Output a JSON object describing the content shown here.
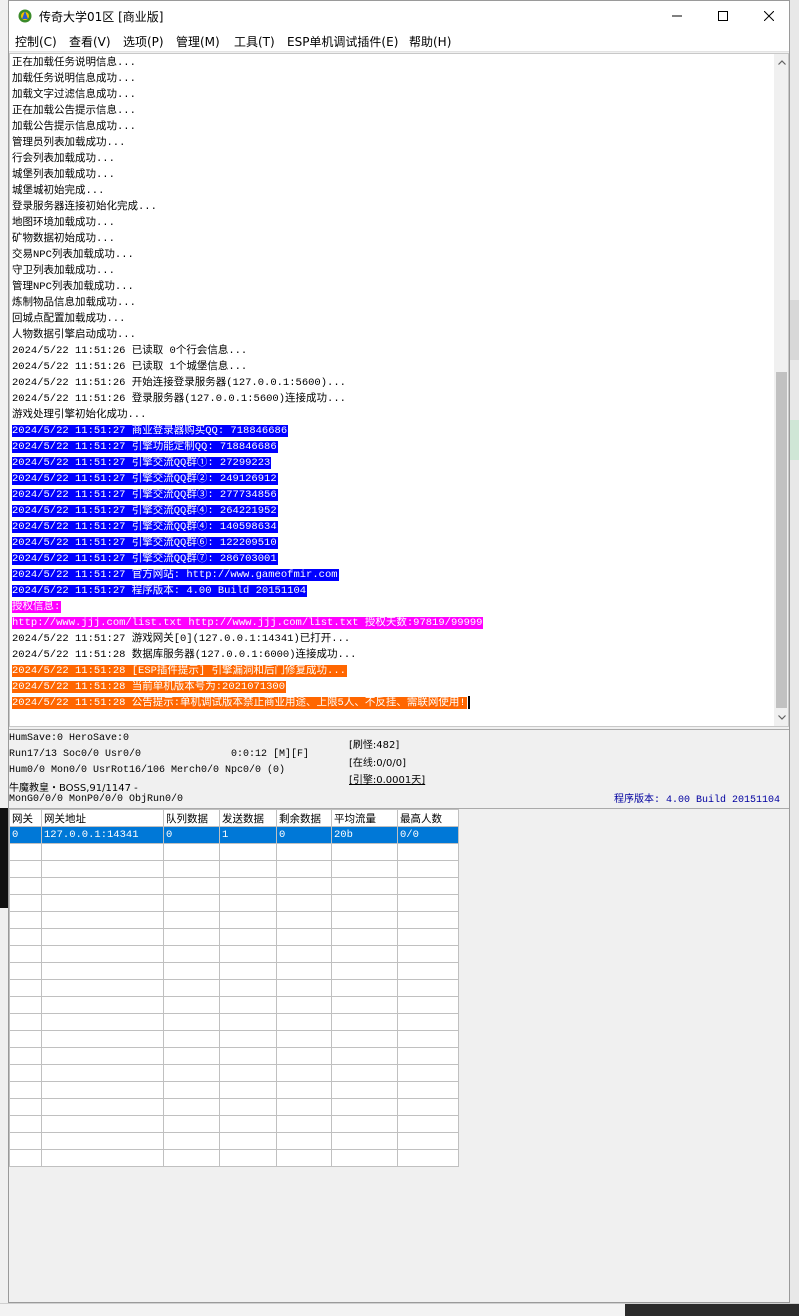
{
  "window": {
    "title": "传奇大学01区 [商业版]"
  },
  "menu": [
    "控制(C)",
    "查看(V)",
    "选项(P)",
    "管理(M)",
    "工具(T)",
    "ESP单机调试插件(E)",
    "帮助(H)"
  ],
  "log": [
    {
      "text": "正在加载任务说明信息...",
      "style": "normal"
    },
    {
      "text": "加载任务说明信息成功...",
      "style": "normal"
    },
    {
      "text": "加载文字过滤信息成功...",
      "style": "normal"
    },
    {
      "text": "正在加载公告提示信息...",
      "style": "normal"
    },
    {
      "text": "加载公告提示信息成功...",
      "style": "normal"
    },
    {
      "text": "管理员列表加载成功...",
      "style": "normal"
    },
    {
      "text": "行会列表加载成功...",
      "style": "normal"
    },
    {
      "text": "城堡列表加载成功...",
      "style": "normal"
    },
    {
      "text": "城堡城初始完成...",
      "style": "normal"
    },
    {
      "text": "登录服务器连接初始化完成...",
      "style": "normal"
    },
    {
      "text": "地图环境加载成功...",
      "style": "normal"
    },
    {
      "text": "矿物数据初始成功...",
      "style": "normal"
    },
    {
      "text": "交易NPC列表加载成功...",
      "style": "normal"
    },
    {
      "text": "守卫列表加载成功...",
      "style": "normal"
    },
    {
      "text": "管理NPC列表加载成功...",
      "style": "normal"
    },
    {
      "text": "炼制物品信息加载成功...",
      "style": "normal"
    },
    {
      "text": "回城点配置加载成功...",
      "style": "normal"
    },
    {
      "text": "人物数据引擎启动成功...",
      "style": "normal"
    },
    {
      "text": "2024/5/22 11:51:26 已读取 0个行会信息...",
      "style": "normal"
    },
    {
      "text": "2024/5/22 11:51:26 已读取 1个城堡信息...",
      "style": "normal"
    },
    {
      "text": "2024/5/22 11:51:26 开始连接登录服务器(127.0.0.1:5600)...",
      "style": "normal"
    },
    {
      "text": "2024/5/22 11:51:26 登录服务器(127.0.0.1:5600)连接成功...",
      "style": "normal"
    },
    {
      "text": "游戏处理引擎初始化成功...",
      "style": "normal"
    },
    {
      "text": "2024/5/22 11:51:27 商业登录器购买QQ: 718846686",
      "style": "blue"
    },
    {
      "text": "2024/5/22 11:51:27 引擎功能定制QQ: 718846686",
      "style": "blue"
    },
    {
      "text": "2024/5/22 11:51:27 引擎交流QQ群①: 27299223",
      "style": "blue"
    },
    {
      "text": "2024/5/22 11:51:27 引擎交流QQ群②: 249126912",
      "style": "blue"
    },
    {
      "text": "2024/5/22 11:51:27 引擎交流QQ群③: 277734856",
      "style": "blue"
    },
    {
      "text": "2024/5/22 11:51:27 引擎交流QQ群④: 264221952",
      "style": "blue"
    },
    {
      "text": "2024/5/22 11:51:27 引擎交流QQ群④: 140598634",
      "style": "blue"
    },
    {
      "text": "2024/5/22 11:51:27 引擎交流QQ群⑥: 122209510",
      "style": "blue"
    },
    {
      "text": "2024/5/22 11:51:27 引擎交流QQ群⑦: 286703001",
      "style": "blue"
    },
    {
      "text": "2024/5/22 11:51:27 官方网站: http://www.gameofmir.com",
      "style": "blue"
    },
    {
      "text": "2024/5/22 11:51:27 程序版本: 4.00 Build 20151104",
      "style": "blue"
    },
    {
      "text": "授权信息:",
      "style": "magenta"
    },
    {
      "text": "http://www.jjj.com/list.txt http://www.jjj.com/list.txt 授权天数:97819/99999",
      "style": "magenta"
    },
    {
      "text": "2024/5/22 11:51:27 游戏网关[0](127.0.0.1:14341)已打开...",
      "style": "normal"
    },
    {
      "text": "2024/5/22 11:51:28 数据库服务器(127.0.0.1:6000)连接成功...",
      "style": "normal"
    },
    {
      "text": "2024/5/22 11:51:28 [ESP插件提示] 引擎漏洞和后门修复成功...",
      "style": "orange"
    },
    {
      "text": "2024/5/22 11:51:28 当前单机版本号为:2021071300",
      "style": "orange"
    },
    {
      "text": "2024/5/22 11:51:28 公告提示:单机调试版本禁止商业用途、上限5人、不反挂、需联网使用!",
      "style": "orange"
    }
  ],
  "status": {
    "line1": "HumSave:0 HeroSave:0",
    "line2_left": "Run17/13 Soc0/0 Usr0/0",
    "line2_time": "0:0:12 [M][F]",
    "line3": "Hum0/0 Mon0/0 UsrRot16/106 Merch0/0 Npc0/0 (0)",
    "line4": "牛魔教皇・BOSS,91/1147 -",
    "line5": "MonG0/0/0 MonP0/0/0 ObjRun0/0",
    "refresh_monster": "[刷怪:482]",
    "online": "[在线:0/0/0]",
    "engine": "[引擎:0.0001天]",
    "program_version": "程序版本: 4.00 Build 20151104"
  },
  "gateway_table": {
    "headers": [
      "网关",
      "网关地址",
      "队列数据",
      "发送数据",
      "剩余数据",
      "平均流量",
      "最高人数"
    ],
    "rows": [
      [
        "0",
        "127.0.0.1:14341",
        "0",
        "1",
        "0",
        "20b",
        "0/0"
      ]
    ],
    "empty_rows": 19
  },
  "icons": {
    "app": "app-icon",
    "minimize": "minimize-icon",
    "maximize": "maximize-icon",
    "close": "close-icon",
    "scroll_up": "scroll-up-icon",
    "scroll_down": "scroll-down-icon"
  },
  "colors": {
    "highlight_blue": "#0000ff",
    "highlight_magenta": "#ff00ff",
    "highlight_orange": "#ff6600",
    "selection": "#0078d7",
    "version_text": "#0000a0"
  }
}
